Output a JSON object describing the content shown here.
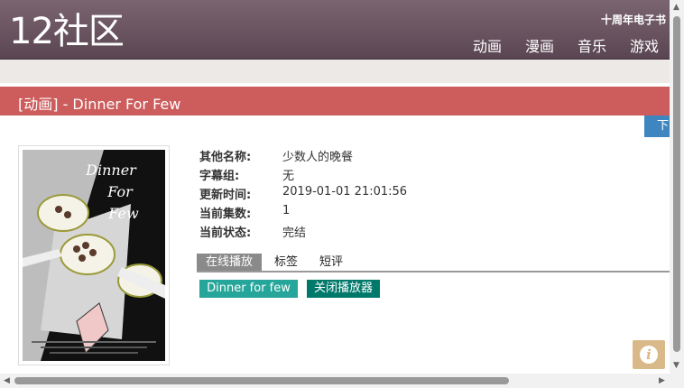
{
  "site": {
    "logo": "12社区",
    "ebook_link": "十周年电子书"
  },
  "nav": [
    {
      "label": "动画"
    },
    {
      "label": "漫画"
    },
    {
      "label": "音乐"
    },
    {
      "label": "游戏"
    }
  ],
  "page": {
    "title": "[动画] - Dinner For Few",
    "download_label": "下"
  },
  "poster": {
    "title_line1": "Dinner",
    "title_line2": "For",
    "title_line3": "Few"
  },
  "details": [
    {
      "key": "其他名称:",
      "value": "少数人的晚餐"
    },
    {
      "key": "字幕组:",
      "value": "无"
    },
    {
      "key": "更新时间:",
      "value": "2019-01-01 21:01:56"
    },
    {
      "key": "当前集数:",
      "value": "1"
    },
    {
      "key": "当前状态:",
      "value": "完结"
    }
  ],
  "tabs": [
    {
      "label": "在线播放"
    },
    {
      "label": "标签"
    },
    {
      "label": "短评"
    }
  ],
  "player": {
    "episode_label": "Dinner for few",
    "close_label": "关闭播放器"
  },
  "colors": {
    "header": "#6b5560",
    "title_bar": "#cd5c5c",
    "episode_btn": "#26a69a",
    "close_btn": "#00796b"
  }
}
